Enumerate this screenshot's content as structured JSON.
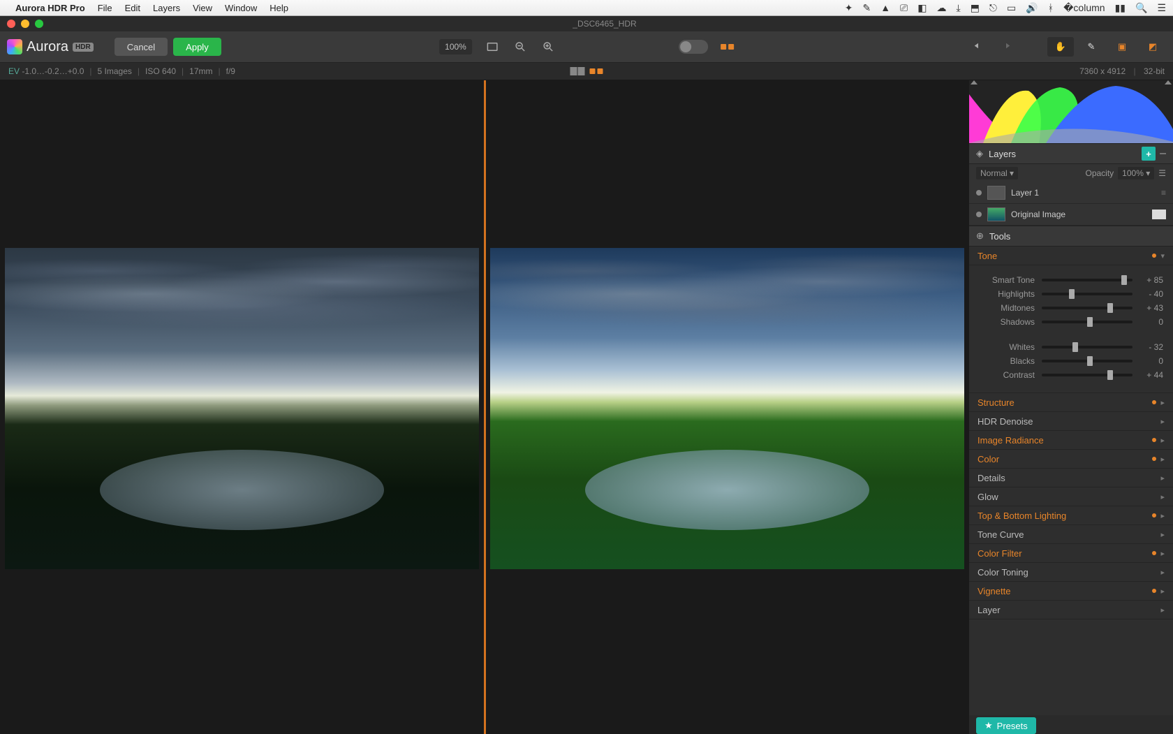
{
  "menubar": {
    "app": "Aurora HDR Pro",
    "items": [
      "File",
      "Edit",
      "Layers",
      "View",
      "Window",
      "Help"
    ]
  },
  "window": {
    "title": "_DSC6465_HDR"
  },
  "toolbar": {
    "logo_text": "Aurora",
    "logo_badge": "HDR",
    "cancel": "Cancel",
    "apply": "Apply",
    "zoom": "100%"
  },
  "infobar": {
    "ev_label": "EV",
    "ev_values": "-1.0…-0.2…+0.0",
    "images": "5 Images",
    "iso": "ISO 640",
    "focal": "17mm",
    "aperture": "f/9",
    "dims": "7360 x 4912",
    "bits": "32-bit"
  },
  "layers": {
    "header": "Layers",
    "blend": "Normal",
    "opacity_label": "Opacity",
    "opacity_value": "100%",
    "items": [
      {
        "name": "Layer 1"
      },
      {
        "name": "Original Image"
      }
    ]
  },
  "tools": {
    "header": "Tools",
    "tone": {
      "label": "Tone",
      "sliders": [
        {
          "name": "Smart Tone",
          "value": 85,
          "pos": 88
        },
        {
          "name": "Highlights",
          "value": -40,
          "pos": 30
        },
        {
          "name": "Midtones",
          "value": 43,
          "pos": 72
        },
        {
          "name": "Shadows",
          "value": 0,
          "pos": 50
        },
        {
          "name": "Whites",
          "value": -32,
          "pos": 34
        },
        {
          "name": "Blacks",
          "value": 0,
          "pos": 50
        },
        {
          "name": "Contrast",
          "value": 44,
          "pos": 72
        }
      ]
    },
    "sections": [
      {
        "name": "Structure",
        "active": true
      },
      {
        "name": "HDR Denoise",
        "active": false
      },
      {
        "name": "Image Radiance",
        "active": true
      },
      {
        "name": "Color",
        "active": true
      },
      {
        "name": "Details",
        "active": false
      },
      {
        "name": "Glow",
        "active": false
      },
      {
        "name": "Top & Bottom Lighting",
        "active": true
      },
      {
        "name": "Tone Curve",
        "active": false
      },
      {
        "name": "Color Filter",
        "active": true
      },
      {
        "name": "Color Toning",
        "active": false
      },
      {
        "name": "Vignette",
        "active": true
      },
      {
        "name": "Layer",
        "active": false
      }
    ]
  },
  "presets": {
    "label": "Presets"
  }
}
